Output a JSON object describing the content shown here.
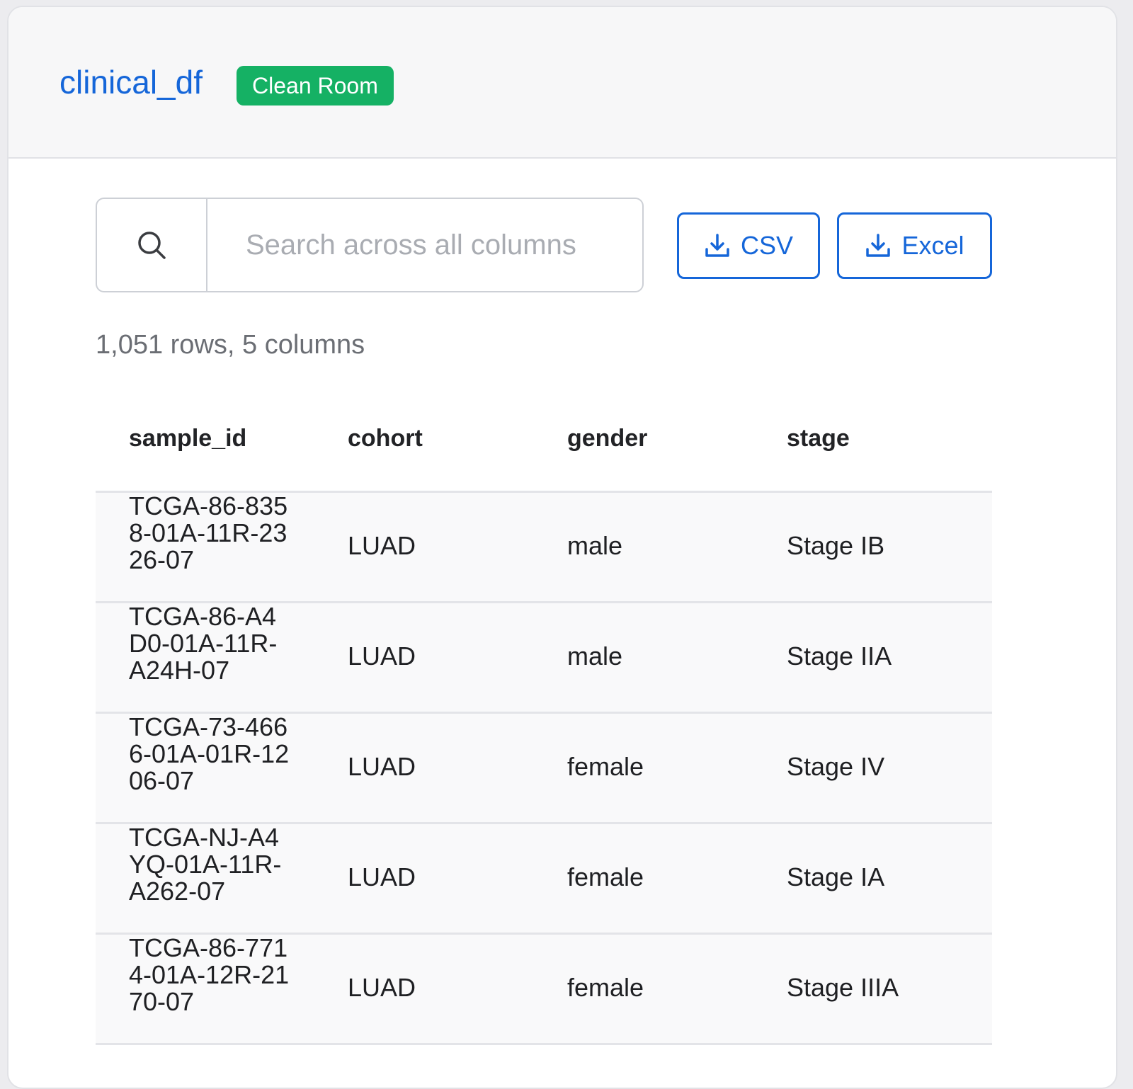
{
  "header": {
    "title": "clinical_df",
    "badge": "Clean Room"
  },
  "search": {
    "placeholder": "Search across all columns",
    "value": ""
  },
  "downloads": {
    "csv_label": "CSV",
    "excel_label": "Excel"
  },
  "summary": "1,051 rows, 5 columns",
  "table": {
    "columns": [
      "sample_id",
      "cohort",
      "gender",
      "stage"
    ],
    "rows": [
      [
        "TCGA-86-8358-01A-11R-2326-07",
        "LUAD",
        "male",
        "Stage IB"
      ],
      [
        "TCGA-86-A4D0-01A-11R-A24H-07",
        "LUAD",
        "male",
        "Stage IIA"
      ],
      [
        "TCGA-73-4666-01A-01R-1206-07",
        "LUAD",
        "female",
        "Stage IV"
      ],
      [
        "TCGA-NJ-A4YQ-01A-11R-A262-07",
        "LUAD",
        "female",
        "Stage IA"
      ],
      [
        "TCGA-86-7714-01A-12R-2170-07",
        "LUAD",
        "female",
        "Stage IIIA"
      ]
    ]
  },
  "colors": {
    "accent": "#1566d9",
    "badge": "#15b164"
  },
  "icons": {
    "search": "search-icon",
    "download": "download-icon"
  }
}
